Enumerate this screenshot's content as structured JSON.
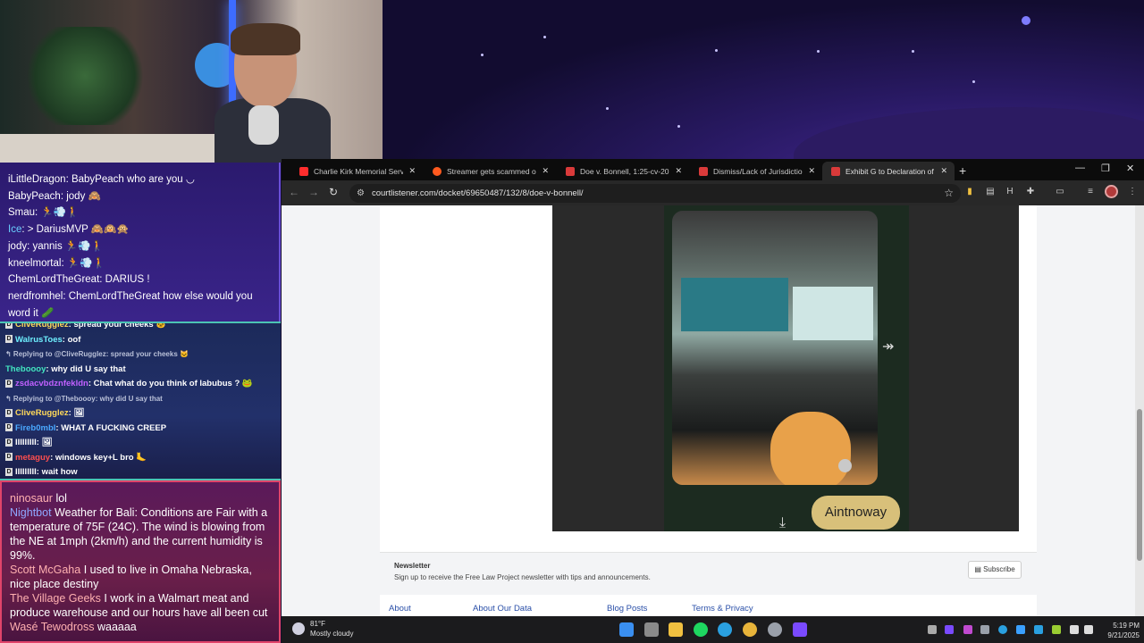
{
  "stream": {
    "chat_top": [
      {
        "user": "iLittleDragon",
        "text": "BabyPeach who are you ◡"
      },
      {
        "user": "BabyPeach",
        "text": "jody 🙈"
      },
      {
        "user": "Smau",
        "text": "🏃💨🚶"
      },
      {
        "user": "Ice",
        "text": "> DariusMVP 🙈🙉🙊"
      },
      {
        "user": "jody",
        "text": "yannis 🏃💨🚶"
      },
      {
        "user": "kneelmortal",
        "text": "🏃💨🚶"
      },
      {
        "user": "ChemLordTheGreat",
        "text": "DARIUS !"
      },
      {
        "user": "nerdfromhel",
        "text": "ChemLordTheGreat how else would you word it 🥒"
      }
    ],
    "chat_mid": [
      {
        "kind": "msg",
        "user": "CliveRugglez",
        "text": "spread your cheeks 🐱",
        "color": "#ffd95a"
      },
      {
        "kind": "msg",
        "user": "WalrusToes",
        "text": "oof",
        "color": "#6ef0ff"
      },
      {
        "kind": "reply",
        "text": "↰ Replying to @CliveRugglez: spread your cheeks 🐱"
      },
      {
        "kind": "msg",
        "user": "Theboooy",
        "text": "why did U say that",
        "color": "#42e6c0"
      },
      {
        "kind": "msg",
        "user": "zsdacvbdznfekldn",
        "text": "Chat what do you think of labubus ? 🐸",
        "color": "#c060ff"
      },
      {
        "kind": "reply",
        "text": "↰ Replying to @Theboooy: why did U say that"
      },
      {
        "kind": "msg",
        "user": "CliveRugglez",
        "text": "🖼",
        "color": "#ffd95a"
      },
      {
        "kind": "msg",
        "user": "Fireb0mbI",
        "text": "WHAT A FUCKING CREEP",
        "color": "#4aa8ff"
      },
      {
        "kind": "msg",
        "user": "IIIIIIIII",
        "text": "🖼",
        "color": "#ffffff"
      },
      {
        "kind": "msg",
        "user": "metaguy",
        "text": "windows key+L bro 🦶",
        "color": "#ff4f4f"
      },
      {
        "kind": "msg",
        "user": "IIIIIIIII",
        "text": "wait how",
        "color": "#ffffff"
      }
    ],
    "chat_bot": [
      {
        "user": "ninosaur",
        "text": "lol",
        "color": "#ffb0b0"
      },
      {
        "user": "Nightbot",
        "text": "Weather for Bali: Conditions are Fair with a temperature of 75F (24C). The wind is blowing from the NE at 1mph (2km/h) and the current humidity is 99%.",
        "color": "#8fa8ff"
      },
      {
        "user": "Scott McGaha",
        "text": "I used to live in Omaha Nebraska, nice place destiny",
        "color": "#ffb0b0"
      },
      {
        "user": "The Village Geeks",
        "text": "I work in a Walmart meat and produce warehouse and our hours have all been cut",
        "color": "#ffb0b0"
      },
      {
        "user": "Wasé Tewodross",
        "text": "waaaaa",
        "color": "#ffb0b0"
      }
    ]
  },
  "browser": {
    "tabs": [
      {
        "label": "Charlie Kirk Memorial Service",
        "icon": "youtube-icon",
        "color": "#ff2d2d",
        "active": false
      },
      {
        "label": "Streamer gets scammed out of",
        "icon": "reddit-icon",
        "color": "#ff5a1f",
        "active": false
      },
      {
        "label": "Doe v. Bonnell, 1:25-cv-20757 –",
        "icon": "pdf-icon",
        "color": "#d93a3a",
        "active": false
      },
      {
        "label": "Dismiss/Lack of Jurisdiction – #",
        "icon": "pdf-icon",
        "color": "#d93a3a",
        "active": false
      },
      {
        "label": "Exhibit G to Declaration of Stev",
        "icon": "pdf-icon",
        "color": "#d93a3a",
        "active": true
      }
    ],
    "url": "courtlistener.com/docket/69650487/132/8/doe-v-bonnell/",
    "page": {
      "image_button": "Aintnoway",
      "newsletter_title": "Newsletter",
      "newsletter_desc": "Sign up to receive the Free Law Project newsletter with tips and announcements.",
      "subscribe": "Subscribe",
      "footer": [
        "About",
        "About Our Data",
        "Blog Posts",
        "Terms & Privacy"
      ]
    }
  },
  "taskbar": {
    "temp": "81°F",
    "condition": "Mostly cloudy",
    "time": "5:19 PM",
    "date": "9/21/2025",
    "apps": [
      {
        "name": "windows-start-icon",
        "color": "#3a8ff0"
      },
      {
        "name": "task-view-icon",
        "color": "#8a8a8a"
      },
      {
        "name": "file-explorer-icon",
        "color": "#f0c040"
      },
      {
        "name": "spotify-icon",
        "color": "#1ed760"
      },
      {
        "name": "edge-icon",
        "color": "#2aa0e0"
      },
      {
        "name": "chrome-icon",
        "color": "#e8b43a"
      },
      {
        "name": "steam-icon",
        "color": "#9aa0aa"
      },
      {
        "name": "app-icon",
        "color": "#7a4aff"
      }
    ]
  },
  "colors": {
    "accent_mid_border": "#4bc4b4",
    "accent_bot_border": "#e0446a",
    "link": "#2a4fa8"
  }
}
